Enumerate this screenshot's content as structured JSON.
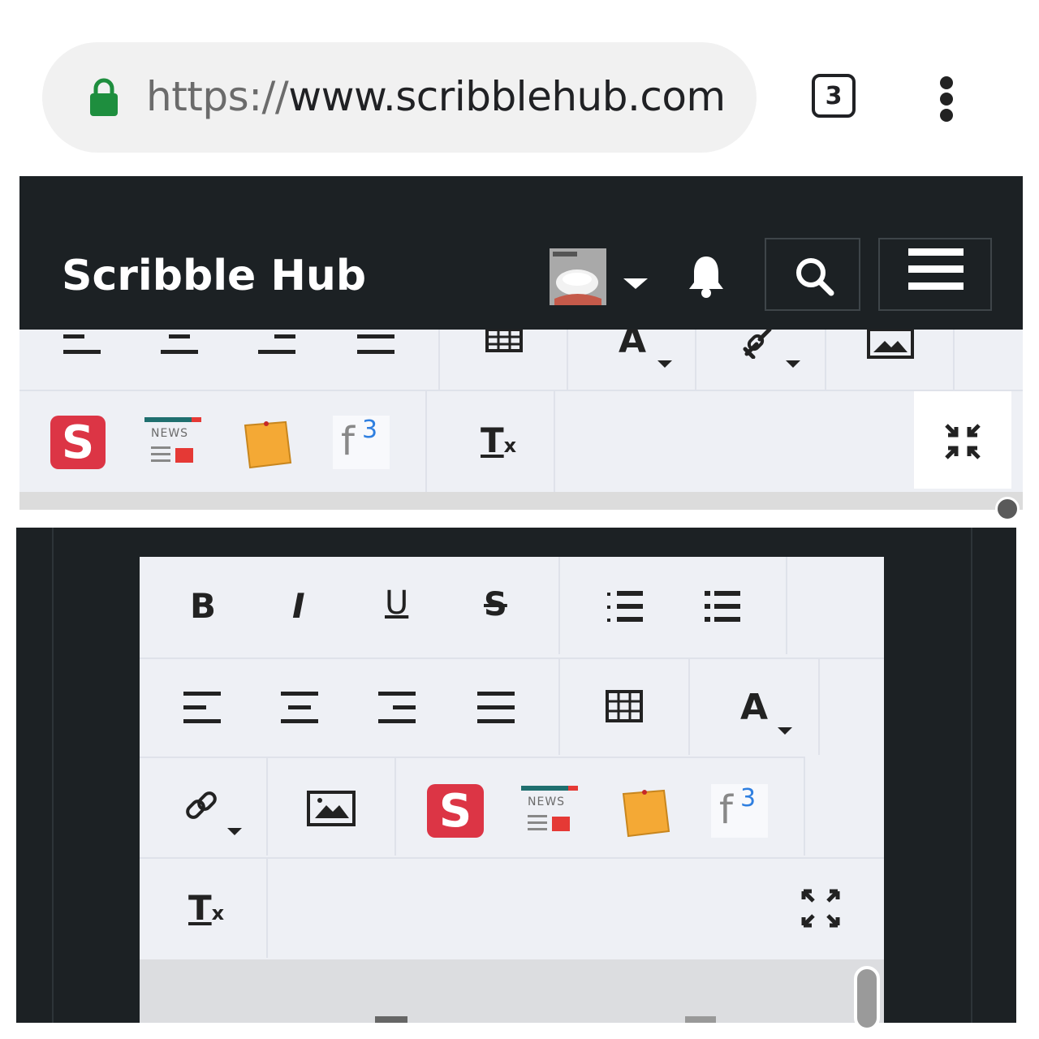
{
  "browser": {
    "url_scheme": "https",
    "url_separator": "://",
    "url_host": "www.scribblehub.com",
    "tab_count": "3",
    "icons": [
      "lock-icon",
      "overflow-menu-icon"
    ]
  },
  "site_header": {
    "brand": "Scribble Hub",
    "icons": [
      "avatar",
      "chevron-down-icon",
      "bell-icon",
      "search-icon",
      "hamburger-menu-icon"
    ]
  },
  "toolbar": {
    "bold": "B",
    "italic": "I",
    "underline": "U",
    "strikethrough": "S",
    "font_color": "A",
    "clear_format": "T",
    "clear_format_sub": "x",
    "news_label": "NEWS",
    "formula_base": "f",
    "formula_sup": "3",
    "scribble_letter": "S"
  },
  "colors": {
    "header_bg": "#1c2124",
    "toolbar_bg": "#eef0f5",
    "lock_green": "#1e8e3e",
    "scribble_red": "#dc3545",
    "note_orange": "#f4a935",
    "formula_blue": "#2f7fe0"
  }
}
